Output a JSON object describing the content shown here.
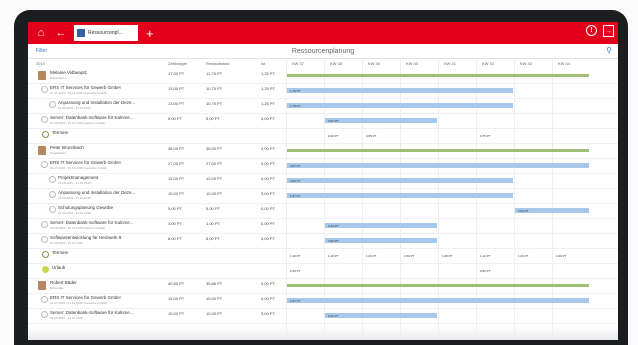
{
  "app": {
    "tab_label": "Ressourcenpl...",
    "page_title": "Ressourcenplanung",
    "filter_label": "Filter"
  },
  "header": {
    "col0": "2013",
    "col1": "Zeitbudget",
    "col2": "Restaufwand",
    "col3": "Ist"
  },
  "weeks": [
    "KW 37",
    "KW 38",
    "KW 39",
    "KW 40",
    "KW 41",
    "KW 42",
    "KW 43",
    "KW 44"
  ],
  "rows": [
    {
      "label": "Melanie Vidbeaptz",
      "sub": "Entwicklerin",
      "type": "person",
      "zb": "17,00 PT",
      "ra": "12,75 PT",
      "ist": "1,25 PT"
    },
    {
      "label": "ERS IT Services für Gewerb GmbH",
      "sub": "01.07.2015 - 31.12.2015 (Gewerbe GmbH)",
      "type": "project",
      "zb": "13,00 PT",
      "ra": "10,75 PT",
      "ist": "1,25 PT"
    },
    {
      "label": "Anpassung und Installation der Deze...",
      "sub": "01.09.2015 - 31.12.2015",
      "type": "task",
      "zb": "13,00 PT",
      "ra": "10,75 PT",
      "ist": "1,25 PT"
    },
    {
      "label": "Server: Datenbank-Software für Kalnme...",
      "sub": "01.09.2015 - 31.12.2015 (Kalnme GmbH)",
      "type": "project",
      "zb": "5,00 PT",
      "ra": "5,00 PT",
      "ist": "0,00 PT"
    },
    {
      "label": "Termine",
      "sub": "",
      "type": "termine",
      "zb": "",
      "ra": "",
      "ist": ""
    },
    {
      "label": "Peter Brunnbach",
      "sub": "Projektleiter",
      "type": "person",
      "zb": "38,00 PT",
      "ra": "36,00 PT",
      "ist": "0,00 PT"
    },
    {
      "label": "ERS IT Services für Gewerb GmbH",
      "sub": "01.07.2015 - 31.12.2015 (Gewerbe GmbH)",
      "type": "project",
      "zb": "27,00 PT",
      "ra": "27,00 PT",
      "ist": "0,00 PT"
    },
    {
      "label": "Projektmanagement",
      "sub": "01.09.2015 - 31.12.2015",
      "type": "task",
      "zb": "12,00 PT",
      "ra": "12,00 PT",
      "ist": "0,00 PT"
    },
    {
      "label": "Anpassung und Installation der Deze...",
      "sub": "01.09.2015 - 31.12.2015",
      "type": "task",
      "zb": "10,00 PT",
      "ra": "10,00 PT",
      "ist": "0,00 PT"
    },
    {
      "label": "Schulungsplanung Gewobe",
      "sub": "01.09.2015 - 31.12.2015",
      "type": "task",
      "zb": "5,00 PT",
      "ra": "5,00 PT",
      "ist": "0,00 PT"
    },
    {
      "label": "Server: Datenbank-Software für Kalnme...",
      "sub": "01.09.2015 - 31.12.2015 (Kalnme GmbH)",
      "type": "project",
      "zb": "3,00 PT",
      "ra": "1,00 PT",
      "ist": "0,00 PT"
    },
    {
      "label": "Softwareentwicklung für Heizwerk 9",
      "sub": "01.09.2015 - 31.12.2015",
      "type": "project",
      "zb": "8,00 PT",
      "ra": "8,00 PT",
      "ist": "0,00 PT"
    },
    {
      "label": "Termine",
      "sub": "",
      "type": "termine",
      "zb": "",
      "ra": "",
      "ist": ""
    },
    {
      "label": "Urlaub",
      "sub": "",
      "type": "urlaub",
      "zb": "",
      "ra": "",
      "ist": ""
    },
    {
      "label": "Robert Bäder",
      "sub": "Entwickler",
      "type": "person",
      "zb": "40,50 PT",
      "ra": "39,86 PT",
      "ist": "0,00 PT"
    },
    {
      "label": "ERS IT Services für Gewerb GmbH",
      "sub": "01.07.2015 - 31.12.2015 (Gewerbe GmbH)",
      "type": "project",
      "zb": "15,00 PT",
      "ra": "15,00 PT",
      "ist": "0,00 PT"
    },
    {
      "label": "Server: Datenbank-Software für Kalnme...",
      "sub": "01.09.2015 - 31.12.2015",
      "type": "project",
      "zb": "10,00 PT",
      "ra": "10,00 PT",
      "ist": "0,00 PT"
    }
  ],
  "cells": [
    {
      "row": 0,
      "col": 0,
      "span": 8,
      "kind": "g",
      "text": ""
    },
    {
      "row": 1,
      "col": 0,
      "span": 6,
      "kind": "b",
      "text": "1,75 PT"
    },
    {
      "row": 2,
      "col": 0,
      "span": 6,
      "kind": "b",
      "text": "1,75 PT"
    },
    {
      "row": 3,
      "col": 1,
      "span": 3,
      "kind": "b",
      "text": "0,67 PT"
    },
    {
      "row": 4,
      "col": 1,
      "span": 1,
      "kind": "t",
      "text": "0,62 PT"
    },
    {
      "row": 4,
      "col": 2,
      "span": 1,
      "kind": "t",
      "text": "0,55 PT"
    },
    {
      "row": 4,
      "col": 5,
      "span": 1,
      "kind": "t",
      "text": "0,75 PT"
    },
    {
      "row": 5,
      "col": 0,
      "span": 8,
      "kind": "g",
      "text": ""
    },
    {
      "row": 6,
      "col": 0,
      "span": 8,
      "kind": "b",
      "text": "3,67 PT"
    },
    {
      "row": 7,
      "col": 0,
      "span": 6,
      "kind": "b",
      "text": "2,00 PT"
    },
    {
      "row": 8,
      "col": 0,
      "span": 6,
      "kind": "b",
      "text": "1,67 PT"
    },
    {
      "row": 9,
      "col": 6,
      "span": 2,
      "kind": "b",
      "text": "2,50 PT"
    },
    {
      "row": 10,
      "col": 1,
      "span": 3,
      "kind": "b",
      "text": "0,34 PT"
    },
    {
      "row": 11,
      "col": 1,
      "span": 3,
      "kind": "b",
      "text": "4,00 PT"
    },
    {
      "row": 12,
      "col": 0,
      "span": 1,
      "kind": "t",
      "text": "1,10 PT"
    },
    {
      "row": 12,
      "col": 1,
      "span": 1,
      "kind": "t",
      "text": "1,10 PT"
    },
    {
      "row": 12,
      "col": 2,
      "span": 1,
      "kind": "t",
      "text": "1,00 PT"
    },
    {
      "row": 12,
      "col": 3,
      "span": 1,
      "kind": "t",
      "text": "1,50 PT"
    },
    {
      "row": 12,
      "col": 4,
      "span": 1,
      "kind": "t",
      "text": "1,60 PT"
    },
    {
      "row": 12,
      "col": 5,
      "span": 1,
      "kind": "t",
      "text": "1,12 PT"
    },
    {
      "row": 12,
      "col": 6,
      "span": 1,
      "kind": "t",
      "text": "1,00 PT"
    },
    {
      "row": 12,
      "col": 7,
      "span": 1,
      "kind": "t",
      "text": "1,00 PT"
    },
    {
      "row": 13,
      "col": 0,
      "span": 1,
      "kind": "t",
      "text": "2,50 PT"
    },
    {
      "row": 13,
      "col": 5,
      "span": 1,
      "kind": "t",
      "text": "0,86 PT"
    },
    {
      "row": 14,
      "col": 0,
      "span": 8,
      "kind": "g",
      "text": ""
    },
    {
      "row": 15,
      "col": 0,
      "span": 8,
      "kind": "b",
      "text": "1,67 PT"
    },
    {
      "row": 16,
      "col": 1,
      "span": 3,
      "kind": "b",
      "text": "0,21 PT"
    }
  ]
}
